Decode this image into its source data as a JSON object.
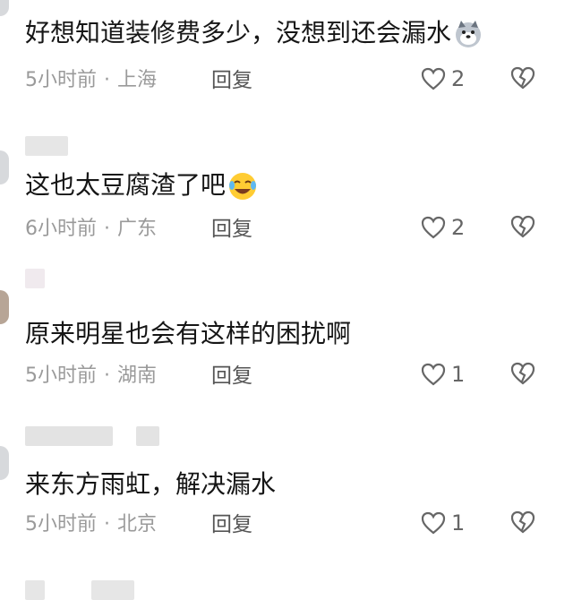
{
  "comments": [
    {
      "text": "好想知道装修费多少，没想到还会漏水",
      "emoji": "dog-emoji",
      "time": "5小时前",
      "location": "上海",
      "reply_label": "回复",
      "likes": "2"
    },
    {
      "text": "这也太豆腐渣了吧",
      "emoji": "laugh-cry-emoji",
      "time": "6小时前",
      "location": "广东",
      "reply_label": "回复",
      "likes": "2"
    },
    {
      "text": "原来明星也会有这样的困扰啊",
      "emoji": "",
      "time": "5小时前",
      "location": "湖南",
      "reply_label": "回复",
      "likes": "1"
    },
    {
      "text": "来东方雨虹，解决漏水",
      "emoji": "",
      "time": "5小时前",
      "location": "北京",
      "reply_label": "回复",
      "likes": "1"
    }
  ],
  "separator": "·"
}
